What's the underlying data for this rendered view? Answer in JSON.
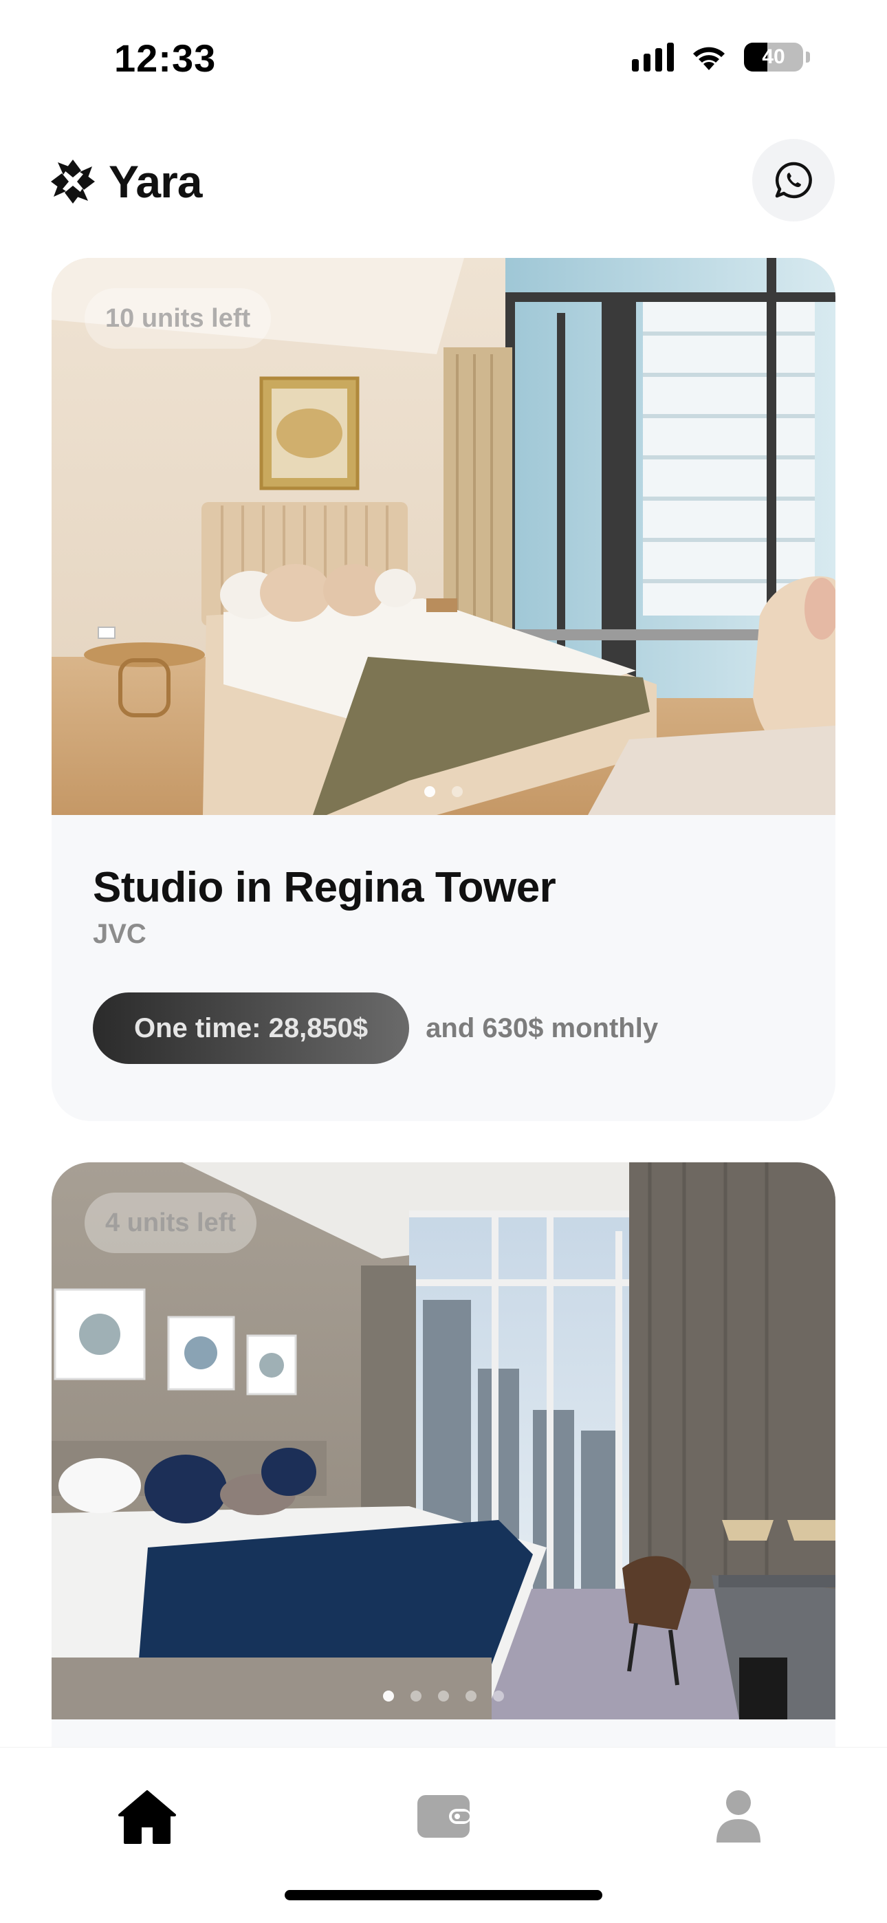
{
  "status_bar": {
    "time": "12:33",
    "battery": "40",
    "battery_level": 0.4
  },
  "header": {
    "app_name": "Yara",
    "logo_icon": "yara-logo-icon",
    "chat_icon": "whatsapp-icon"
  },
  "listings": [
    {
      "units_left": "10 units left",
      "title": "Studio in Regina Tower",
      "location": "JVC",
      "price_one_time": "One time: 28,850$",
      "price_monthly": "and 630$ monthly",
      "photo_count": 2,
      "active_photo": 0
    },
    {
      "units_left": "4 units left",
      "photo_count": 5,
      "active_photo": 0
    }
  ],
  "tab_bar": {
    "items": [
      {
        "name": "home",
        "icon": "home-icon",
        "active": true
      },
      {
        "name": "wallet",
        "icon": "wallet-icon",
        "active": false
      },
      {
        "name": "profile",
        "icon": "profile-icon",
        "active": false
      }
    ]
  },
  "colors": {
    "active_tab": "#000000",
    "inactive_tab": "#a8a8a8",
    "card_bg": "#f7f8fa"
  }
}
